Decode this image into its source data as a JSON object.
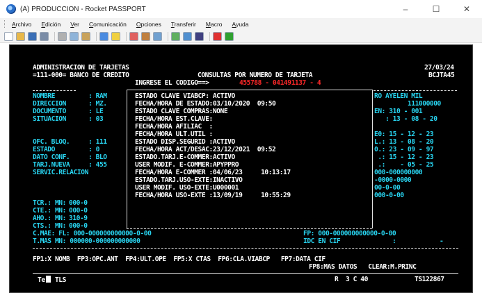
{
  "window": {
    "title": "(A) PRODUCCION - Rocket PASSPORT",
    "minimize": "–",
    "maximize": "☐",
    "close": "✕"
  },
  "menu": [
    "Archivo",
    "Edición",
    "Ver",
    "Comunicación",
    "Opciones",
    "Transferir",
    "Macro",
    "Ayuda"
  ],
  "toolbar": {
    "buttons": [
      {
        "name": "new-icon",
        "color": "#ffffff"
      },
      {
        "name": "open-folder-icon",
        "color": "#e8b84a"
      },
      {
        "name": "save-icon",
        "color": "#3b6fb6"
      },
      {
        "name": "print-icon",
        "color": "#7a8ca6"
      },
      {
        "name": "cut-icon",
        "color": "#b0b0b0"
      },
      {
        "name": "copy-icon",
        "color": "#8fb4d9"
      },
      {
        "name": "paste-icon",
        "color": "#c9a35c"
      },
      {
        "name": "color-icon",
        "color": "#4a8be0"
      },
      {
        "name": "highlight-icon",
        "color": "#f0d040"
      },
      {
        "name": "connect-icon",
        "color": "#e06060"
      },
      {
        "name": "font-icon",
        "color": "#c08040"
      },
      {
        "name": "screen-icon",
        "color": "#70a0d0"
      },
      {
        "name": "transfer-icon",
        "color": "#60b060"
      },
      {
        "name": "transfer2-icon",
        "color": "#5090d0"
      },
      {
        "name": "binoculars-icon",
        "color": "#404080"
      },
      {
        "name": "record-icon",
        "color": "#e03030"
      },
      {
        "name": "play-icon",
        "color": "#30a030"
      }
    ]
  },
  "screen": {
    "title": "ADMINISTRACION DE TARJETAS",
    "date": "27/03/24",
    "bank": "=111-000= BANCO DE CREDITO",
    "query_title": "CONSULTAS POR NUMERO DE TARJETA",
    "program_id": "BCJTA45",
    "prompt": "INGRESE EL CODIGO==>",
    "code_input": "455788 - 041491137 - 4",
    "left_rows": [
      {
        "label": "NOMBRE",
        "value": ": RAM"
      },
      {
        "label": "DIRECCION",
        "value": ": MZ."
      },
      {
        "label": "DOCUMENTO",
        "value": ": LE"
      },
      {
        "label": "SITUACION",
        "value": ": 03"
      }
    ],
    "left_rows2": [
      {
        "label": "OFC. BLOQ.",
        "value": ": 111"
      },
      {
        "label": "ESTADO",
        "value": ": 0"
      },
      {
        "label": "DATO CONF.",
        "value": ": BLO"
      },
      {
        "label": "TARJ.NUEVA",
        "value": ": 455"
      },
      {
        "label": "SERVIC.RELACION",
        "value": ""
      }
    ],
    "left_rows3": [
      {
        "label": "TCR.: MN:",
        "value": "000-0"
      },
      {
        "label": "CTE.: MN:",
        "value": "000-0"
      },
      {
        "label": "AHO.: MN:",
        "value": "310-9"
      },
      {
        "label": "CTS.: MN:",
        "value": "000-0"
      }
    ],
    "popup_lines": [
      "ESTADO CLAVE VIABCP: ACTIVO",
      "FECHA/HORA DE ESTADO:03/10/2020  09:50",
      "ESTADO CLAVE COMPRAS:NONE",
      "FECHA/HORA EST.CLAVE:",
      "FECHA/HORA AFILIAC  :",
      "FECHA/HORA ULT.UTIL :",
      "ESTADO DISP.SEGURID :ACTIVO",
      "FECHA/HORA ACT/DESAC:23/12/2021  09:52",
      "ESTADO.TARJ.E-COMMER:ACTIVO",
      "USER MODIF. E-COMMER:APYPPRO",
      "FECHA/HORA E-COMMER :04/06/23     10:13:17",
      "ESTADO.TARJ.USO-EXTE:INACTIVO",
      "USER MODIF. USO-EXTE:U000001",
      "FECHA/HORA USO-EXTE :13/09/19     10:55:29"
    ],
    "right_lines": [
      {
        "text": "RO AYELEN MIL",
        "cls": "c"
      },
      {
        "text": "         111000000",
        "cls": "c"
      },
      {
        "text": "EN: 310 - 001",
        "cls": "c"
      },
      {
        "text": "   : 13 - 08 - 20",
        "cls": "c"
      },
      {
        "text": "",
        "cls": "c"
      },
      {
        "text": "E0: 15 - 12 - 23",
        "cls": "c"
      },
      {
        "text": "L.: 13 - 08 - 20",
        "cls": "c"
      },
      {
        "text": "0.: 23 - 09 - 97",
        "cls": "c"
      },
      {
        "text": " .: 15 - 12 - 23",
        "cls": "c"
      },
      {
        "text": " .:    - 05 - 25",
        "cls": "c"
      },
      {
        "text": "000-000000000",
        "cls": "c"
      },
      {
        "text": "-0000-0000",
        "cls": "c"
      },
      {
        "text": "00-0-00",
        "cls": "c"
      },
      {
        "text": "000-0-00",
        "cls": "c"
      }
    ],
    "cmae_line": "C.MAE: FL: 000-000000000000-0-00",
    "fp_line": "FP: 000-000000000000-0-00",
    "tmas_line": "T.MAS MN: 000000-000000000000",
    "idc_line": "IDC EN CIF",
    "idc_colon": ":",
    "idc_dash": "-",
    "fkeys_row1": "FP1:X NOMB  FP3:OPC.ANT  FP4:ULT.OPE  FP5:X CTAS  FP6:CLA.VIABCP   FP7:DATA CIF",
    "fkeys_row2": "FP8:MAS DATOS   CLEAR:M.PRINC",
    "status_left": "Te",
    "status_tls": "TLS",
    "status_pos": "R  3 C 40",
    "status_session": "TS122867"
  }
}
